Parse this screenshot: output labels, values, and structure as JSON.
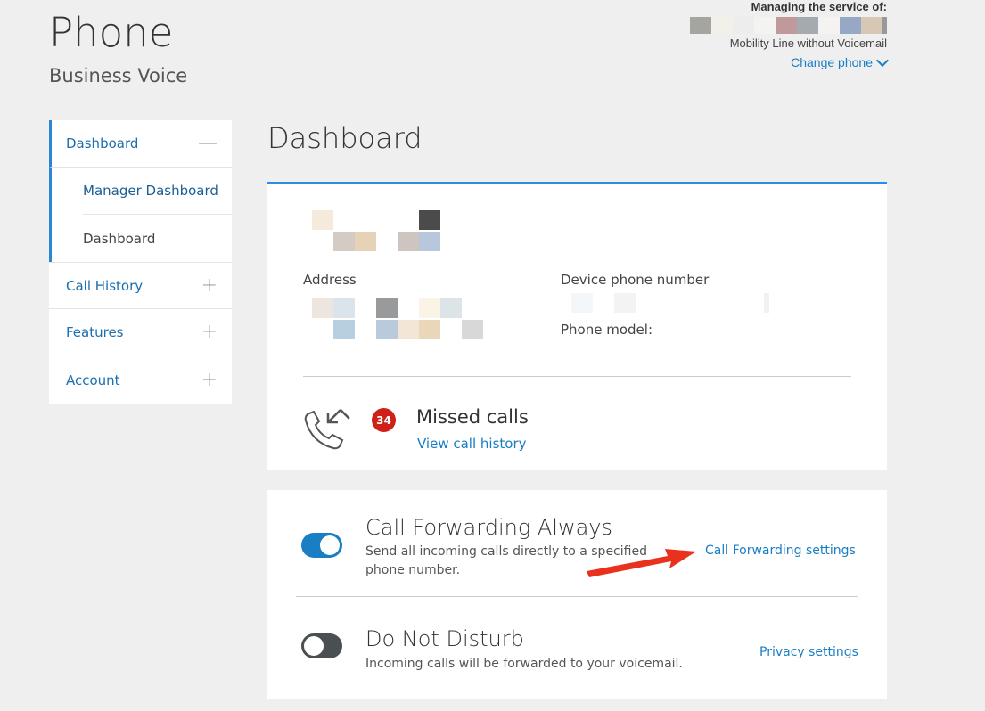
{
  "header": {
    "title": "Phone",
    "subtitle": "Business Voice"
  },
  "account": {
    "managing_label": "Managing the service of:",
    "plan": "Mobility Line without Voicemail",
    "change_phone": "Change phone"
  },
  "sidebar": {
    "items": [
      {
        "label": "Dashboard",
        "sign": "—"
      },
      {
        "label": "Manager Dashboard"
      },
      {
        "label": "Dashboard"
      },
      {
        "label": "Call History",
        "sign": "+"
      },
      {
        "label": "Features",
        "sign": "+"
      },
      {
        "label": "Account",
        "sign": "+"
      }
    ]
  },
  "main": {
    "title": "Dashboard",
    "address_label": "Address",
    "device_number_label": "Device phone number",
    "phone_model_label": "Phone model:",
    "missed": {
      "count": "34",
      "title": "Missed calls",
      "link": "View call history"
    },
    "forwarding": {
      "title": "Call Forwarding Always",
      "desc": "Send all incoming calls directly to a specified phone number.",
      "link": "Call Forwarding settings"
    },
    "dnd": {
      "title": "Do Not Disturb",
      "desc": "Incoming calls will be forwarded to your voicemail.",
      "link": "Privacy settings"
    }
  },
  "colors": {
    "accent": "#1a7ec4",
    "badge": "#d0201a",
    "annotation_arrow": "#e8321e"
  }
}
